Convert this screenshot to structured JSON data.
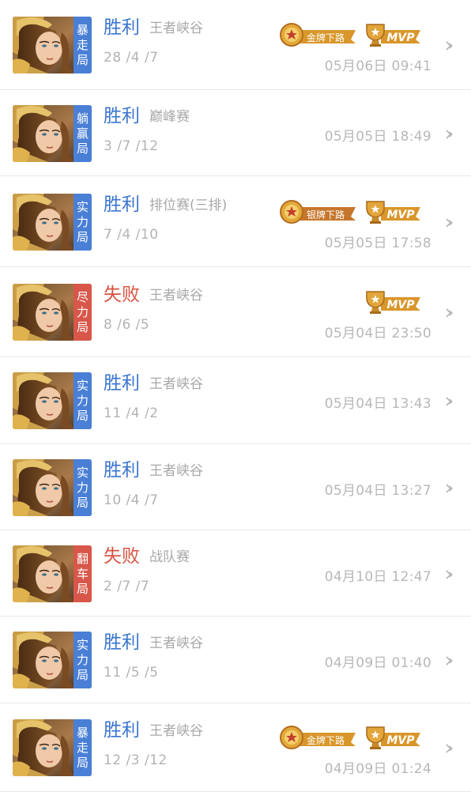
{
  "colors": {
    "win": "#3a75cf",
    "loss": "#d85242",
    "tag_win": "#4a7fd6",
    "tag_loss": "#d8574a",
    "gold": "#d9962a",
    "silver_rank": "#c6762c"
  },
  "matches": [
    {
      "result": "胜利",
      "outcome": "win",
      "mode": "王者峡谷",
      "kda": "28 /4 /7",
      "time": "05月06日 09:41",
      "tag": [
        "暴",
        "走",
        "局"
      ],
      "rank_badge": "金牌下路",
      "mvp": "MVP"
    },
    {
      "result": "胜利",
      "outcome": "win",
      "mode": "巅峰赛",
      "kda": "3 /7 /12",
      "time": "05月05日 18:49",
      "tag": [
        "躺",
        "赢",
        "局"
      ],
      "rank_badge": "",
      "mvp": ""
    },
    {
      "result": "胜利",
      "outcome": "win",
      "mode": "排位赛(三排)",
      "kda": "7 /4 /10",
      "time": "05月05日 17:58",
      "tag": [
        "实",
        "力",
        "局"
      ],
      "rank_badge": "银牌下路",
      "mvp": "MVP"
    },
    {
      "result": "失败",
      "outcome": "loss",
      "mode": "王者峡谷",
      "kda": "8 /6 /5",
      "time": "05月04日 23:50",
      "tag": [
        "尽",
        "力",
        "局"
      ],
      "rank_badge": "",
      "mvp": "MVP"
    },
    {
      "result": "胜利",
      "outcome": "win",
      "mode": "王者峡谷",
      "kda": "11 /4 /2",
      "time": "05月04日 13:43",
      "tag": [
        "实",
        "力",
        "局"
      ],
      "rank_badge": "",
      "mvp": ""
    },
    {
      "result": "胜利",
      "outcome": "win",
      "mode": "王者峡谷",
      "kda": "10 /4 /7",
      "time": "05月04日 13:27",
      "tag": [
        "实",
        "力",
        "局"
      ],
      "rank_badge": "",
      "mvp": ""
    },
    {
      "result": "失败",
      "outcome": "loss",
      "mode": "战队赛",
      "kda": "2 /7 /7",
      "time": "04月10日 12:47",
      "tag": [
        "翻",
        "车",
        "局"
      ],
      "rank_badge": "",
      "mvp": ""
    },
    {
      "result": "胜利",
      "outcome": "win",
      "mode": "王者峡谷",
      "kda": "11 /5 /5",
      "time": "04月09日 01:40",
      "tag": [
        "实",
        "力",
        "局"
      ],
      "rank_badge": "",
      "mvp": ""
    },
    {
      "result": "胜利",
      "outcome": "win",
      "mode": "王者峡谷",
      "kda": "12 /3 /12",
      "time": "04月09日 01:24",
      "tag": [
        "暴",
        "走",
        "局"
      ],
      "rank_badge": "金牌下路",
      "mvp": "MVP"
    }
  ]
}
